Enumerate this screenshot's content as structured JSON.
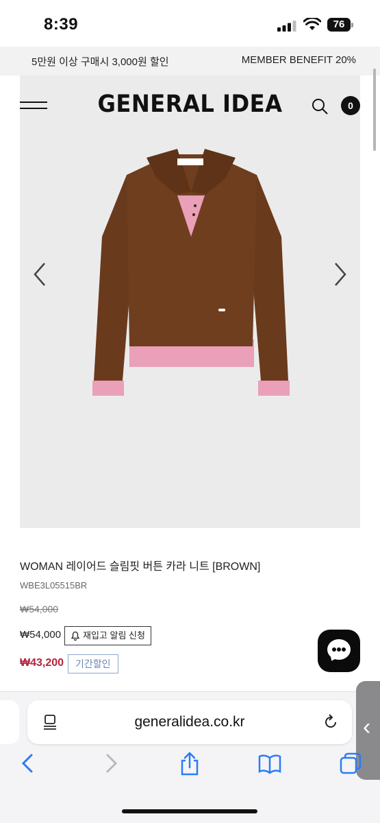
{
  "status_bar": {
    "time": "8:39",
    "battery": "76"
  },
  "promo": {
    "left_text": "5만원 이상 구매시 3,000원 할인",
    "right_text": "MEMBER BENEFIT 20%"
  },
  "header": {
    "logo": "GENERAL IDEA",
    "cart_count": "0"
  },
  "product": {
    "title": "WOMAN 레이어드 슬림핏 버튼 카라 니트 [BROWN]",
    "code": "WBE3L05515BR",
    "original_price": "₩54,000",
    "price": "₩54,000",
    "restock_label": "재입고 알림 신청",
    "sale_price": "₩43,200",
    "sale_badge": "기간할인",
    "colors": {
      "sale": "#b4243b",
      "badge": "#6b86b8"
    }
  },
  "browser": {
    "url": "generalidea.co.kr"
  },
  "icons": [
    "hamburger-icon",
    "search-icon",
    "prev-arrow-icon",
    "next-arrow-icon",
    "bell-icon",
    "chat-icon",
    "page-menu-icon",
    "reload-icon",
    "back-icon",
    "forward-icon",
    "share-icon",
    "bookmarks-icon",
    "tabs-icon"
  ]
}
